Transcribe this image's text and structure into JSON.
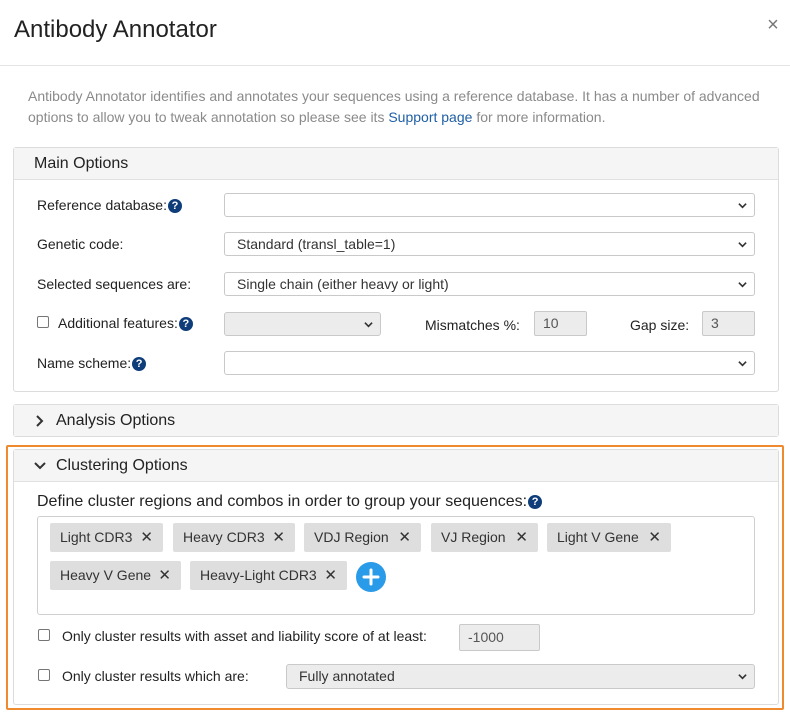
{
  "dialog": {
    "title": "Antibody Annotator",
    "close_icon": "×",
    "description_text": "Antibody Annotator identifies and annotates your sequences using a reference database. It has a number of advanced options to allow you to tweak annotation so please see its",
    "support_link": "Support page",
    "description_suffix": "for more information."
  },
  "main_options": {
    "header": "Main Options",
    "reference_database_label": "Reference database:",
    "reference_database_value": "",
    "genetic_code_label": "Genetic code:",
    "genetic_code_value": "Standard (transl_table=1)",
    "selected_sequences_label": "Selected sequences are:",
    "selected_sequences_value": "Single chain (either heavy or light)",
    "additional_features_label": "Additional features:",
    "additional_features_value": "",
    "mismatches_label": "Mismatches %:",
    "mismatches_value": "10",
    "gap_size_label": "Gap size:",
    "gap_size_value": "3",
    "name_scheme_label": "Name scheme:",
    "name_scheme_value": ""
  },
  "analysis_options": {
    "header": "Analysis Options",
    "expanded": false
  },
  "clustering_options": {
    "header": "Clustering Options",
    "expanded": true,
    "define_label": "Define cluster regions and combos in order to group your sequences:",
    "tags": [
      "Light CDR3",
      "Heavy CDR3",
      "VDJ Region",
      "VJ Region",
      "Light V Gene",
      "Heavy V Gene",
      "Heavy-Light CDR3"
    ],
    "asset_score_label": "Only cluster results with asset and liability score of at least:",
    "asset_score_value": "-1000",
    "cluster_which_label": "Only cluster results which are:",
    "cluster_which_value": "Fully annotated"
  },
  "colors": {
    "highlight": "#f08a2f",
    "help_icon": "#0e3d7a",
    "add_button": "#2a9be8",
    "link": "#1f5fa5"
  }
}
